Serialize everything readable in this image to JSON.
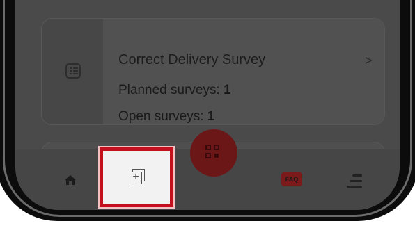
{
  "survey_card": {
    "title": "Correct Delivery Survey",
    "chevron": ">",
    "planned_label": "Planned surveys: ",
    "planned_value": "1",
    "open_label": "Open surveys: ",
    "open_value": "1",
    "icon": "list-icon"
  },
  "nav": {
    "items": [
      "home-icon",
      "add-survey-icon",
      "qr-scan-icon",
      "faq-icon",
      "menu-icon"
    ],
    "faq_label": "FAQ"
  },
  "colors": {
    "highlight_border": "#c4101d",
    "fab": "#6c1717",
    "faq": "#7b1a1a"
  }
}
